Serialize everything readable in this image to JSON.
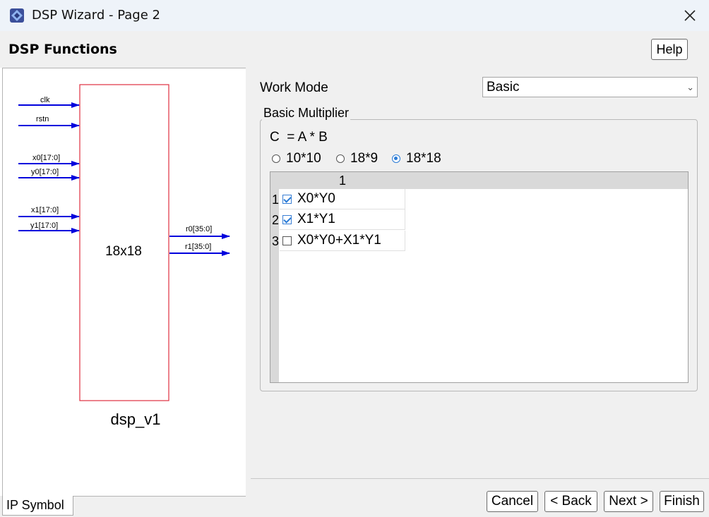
{
  "window": {
    "title": "DSP Wizard - Page 2",
    "app_icon": "dsp-wizard-icon",
    "close_icon": "close-icon"
  },
  "header": {
    "title": "DSP Functions",
    "help_label": "Help"
  },
  "symbol": {
    "inputs": [
      "clk",
      "rstn",
      "x0[17:0]",
      "y0[17:0]",
      "x1[17:0]",
      "y1[17:0]"
    ],
    "outputs": [
      "r0[35:0]",
      "r1[35:0]"
    ],
    "block_label": "18x18",
    "instance_name": "dsp_v1",
    "pin_color": "#0000dd",
    "block_color": "#e03040"
  },
  "tabs": {
    "ip_symbol": "IP Symbol"
  },
  "work_mode": {
    "label": "Work Mode",
    "value": "Basic",
    "chevron_icon": "chevron-down-icon"
  },
  "basic_multiplier": {
    "legend": "Basic Multiplier",
    "formula": "C  = A * B",
    "sizes": [
      {
        "label": "10*10",
        "selected": false
      },
      {
        "label": "18*9",
        "selected": false
      },
      {
        "label": "18*18",
        "selected": true
      }
    ],
    "table": {
      "column_header": "1",
      "rows": [
        {
          "num": "1",
          "label": "X0*Y0",
          "checked": true
        },
        {
          "num": "2",
          "label": "X1*Y1",
          "checked": true
        },
        {
          "num": "3",
          "label": "X0*Y0+X1*Y1",
          "checked": false
        }
      ]
    }
  },
  "footer": {
    "cancel": "Cancel",
    "back": "< Back",
    "next": "Next >",
    "finish": "Finish"
  },
  "colors": {
    "accent": "#2a7bd6",
    "titlebar_bg": "#eef3f9",
    "panel_bg": "#f0f0f0"
  }
}
